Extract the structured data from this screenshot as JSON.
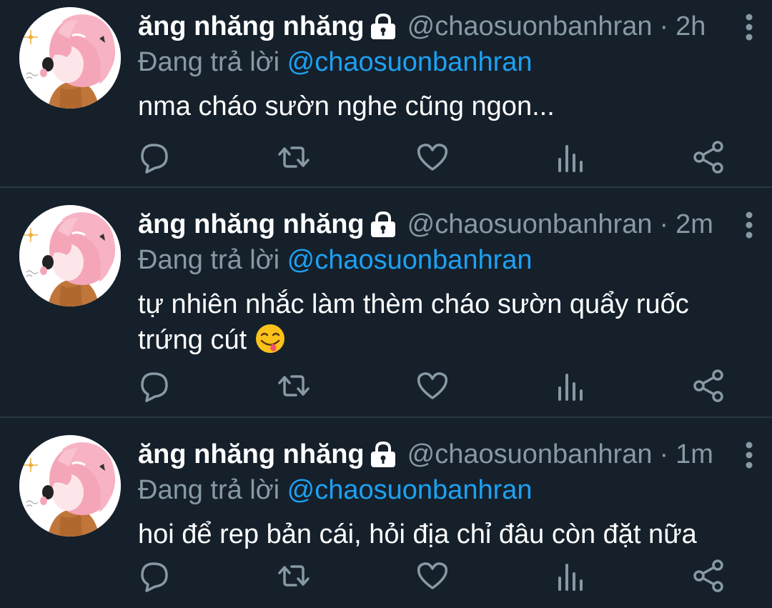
{
  "colors": {
    "background": "#15202b",
    "divider": "#2a3642",
    "muted": "#8899a6",
    "accent": "#1da1f2",
    "text": "#ffffff"
  },
  "tweets": [
    {
      "display_name": "ăng nhăng nhăng",
      "handle": "@chaosuonbanhran",
      "separator": "·",
      "time": "2h",
      "reply_prefix": "Đang trả lời",
      "reply_mention": "@chaosuonbanhran",
      "text": "nma cháo sườn nghe cũng ngon...",
      "icons": [
        "lock-icon",
        "more-icon",
        "reply-icon",
        "retweet-icon",
        "like-icon",
        "stats-icon",
        "share-icon"
      ]
    },
    {
      "display_name": "ăng nhăng nhăng",
      "handle": "@chaosuonbanhran",
      "separator": "·",
      "time": "2m",
      "reply_prefix": "Đang trả lời",
      "reply_mention": "@chaosuonbanhran",
      "text": "tự nhiên nhắc làm thèm cháo sườn quẩy ruốc trứng cút",
      "emoji": "yum-face-emoji",
      "icons": [
        "lock-icon",
        "more-icon",
        "reply-icon",
        "retweet-icon",
        "like-icon",
        "stats-icon",
        "share-icon"
      ]
    },
    {
      "display_name": "ăng nhăng nhăng",
      "handle": "@chaosuonbanhran",
      "separator": "·",
      "time": "1m",
      "reply_prefix": "Đang trả lời",
      "reply_mention": "@chaosuonbanhran",
      "text": "hoi để rep bản cái, hỏi địa chỉ đâu còn đặt nữa",
      "icons": [
        "lock-icon",
        "more-icon",
        "reply-icon",
        "retweet-icon",
        "like-icon",
        "stats-icon",
        "share-icon"
      ]
    }
  ]
}
